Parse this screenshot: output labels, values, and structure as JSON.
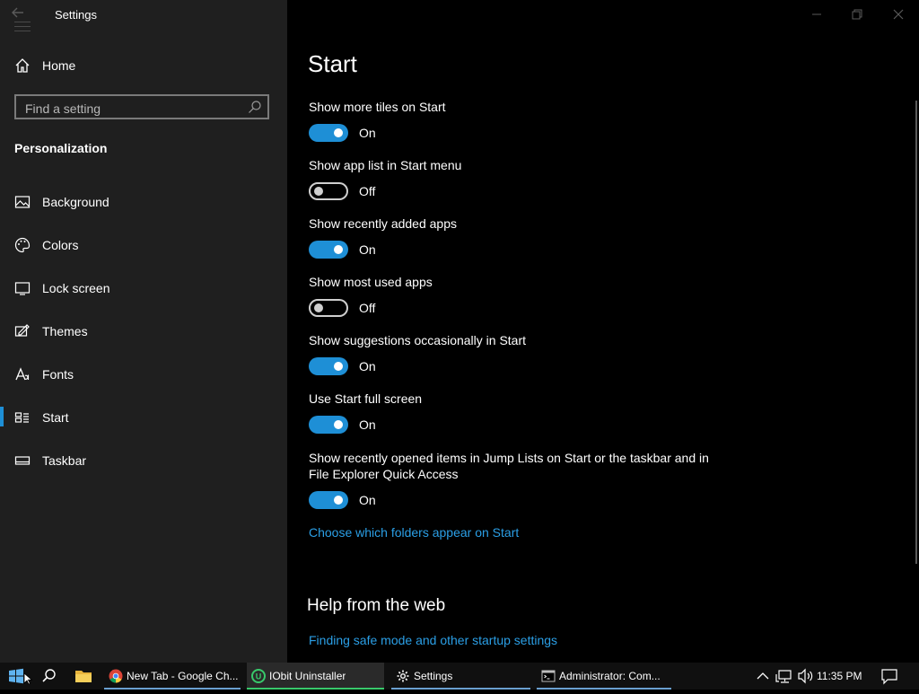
{
  "window": {
    "title": "Settings"
  },
  "sidebar": {
    "home_label": "Home",
    "search_placeholder": "Find a setting",
    "section_title": "Personalization",
    "items": [
      {
        "label": "Background",
        "icon": "picture-icon"
      },
      {
        "label": "Colors",
        "icon": "palette-icon"
      },
      {
        "label": "Lock screen",
        "icon": "lock-screen-icon"
      },
      {
        "label": "Themes",
        "icon": "themes-icon"
      },
      {
        "label": "Fonts",
        "icon": "fonts-icon"
      },
      {
        "label": "Start",
        "icon": "start-tiles-icon",
        "active": true
      },
      {
        "label": "Taskbar",
        "icon": "taskbar-icon"
      }
    ]
  },
  "main": {
    "page_title": "Start",
    "settings": [
      {
        "label": "Show more tiles on Start",
        "state": "On"
      },
      {
        "label": "Show app list in Start menu",
        "state": "Off"
      },
      {
        "label": "Show recently added apps",
        "state": "On"
      },
      {
        "label": "Show most used apps",
        "state": "Off"
      },
      {
        "label": "Show suggestions occasionally in Start",
        "state": "On"
      },
      {
        "label": "Use Start full screen",
        "state": "On"
      },
      {
        "label_line1": "Show recently opened items in Jump Lists on Start or the taskbar and in",
        "label_line2": "File Explorer Quick Access",
        "state": "On"
      }
    ],
    "folders_link": "Choose which folders appear on Start",
    "help_title": "Help from the web",
    "help_link": "Finding safe mode and other startup settings"
  },
  "taskbar": {
    "apps": [
      {
        "label": "New Tab - Google Ch...",
        "icon": "chrome-icon"
      },
      {
        "label": "IObit Uninstaller",
        "icon": "iobit-icon"
      },
      {
        "label": "Settings",
        "icon": "gear-icon"
      },
      {
        "label": "Administrator:  Com...",
        "icon": "command-prompt-icon"
      }
    ],
    "clock": "11:35 PM"
  },
  "colors": {
    "accent": "#1e8fd6",
    "link": "#2b9fe6",
    "sidebar_bg": "#1f1f1f"
  }
}
